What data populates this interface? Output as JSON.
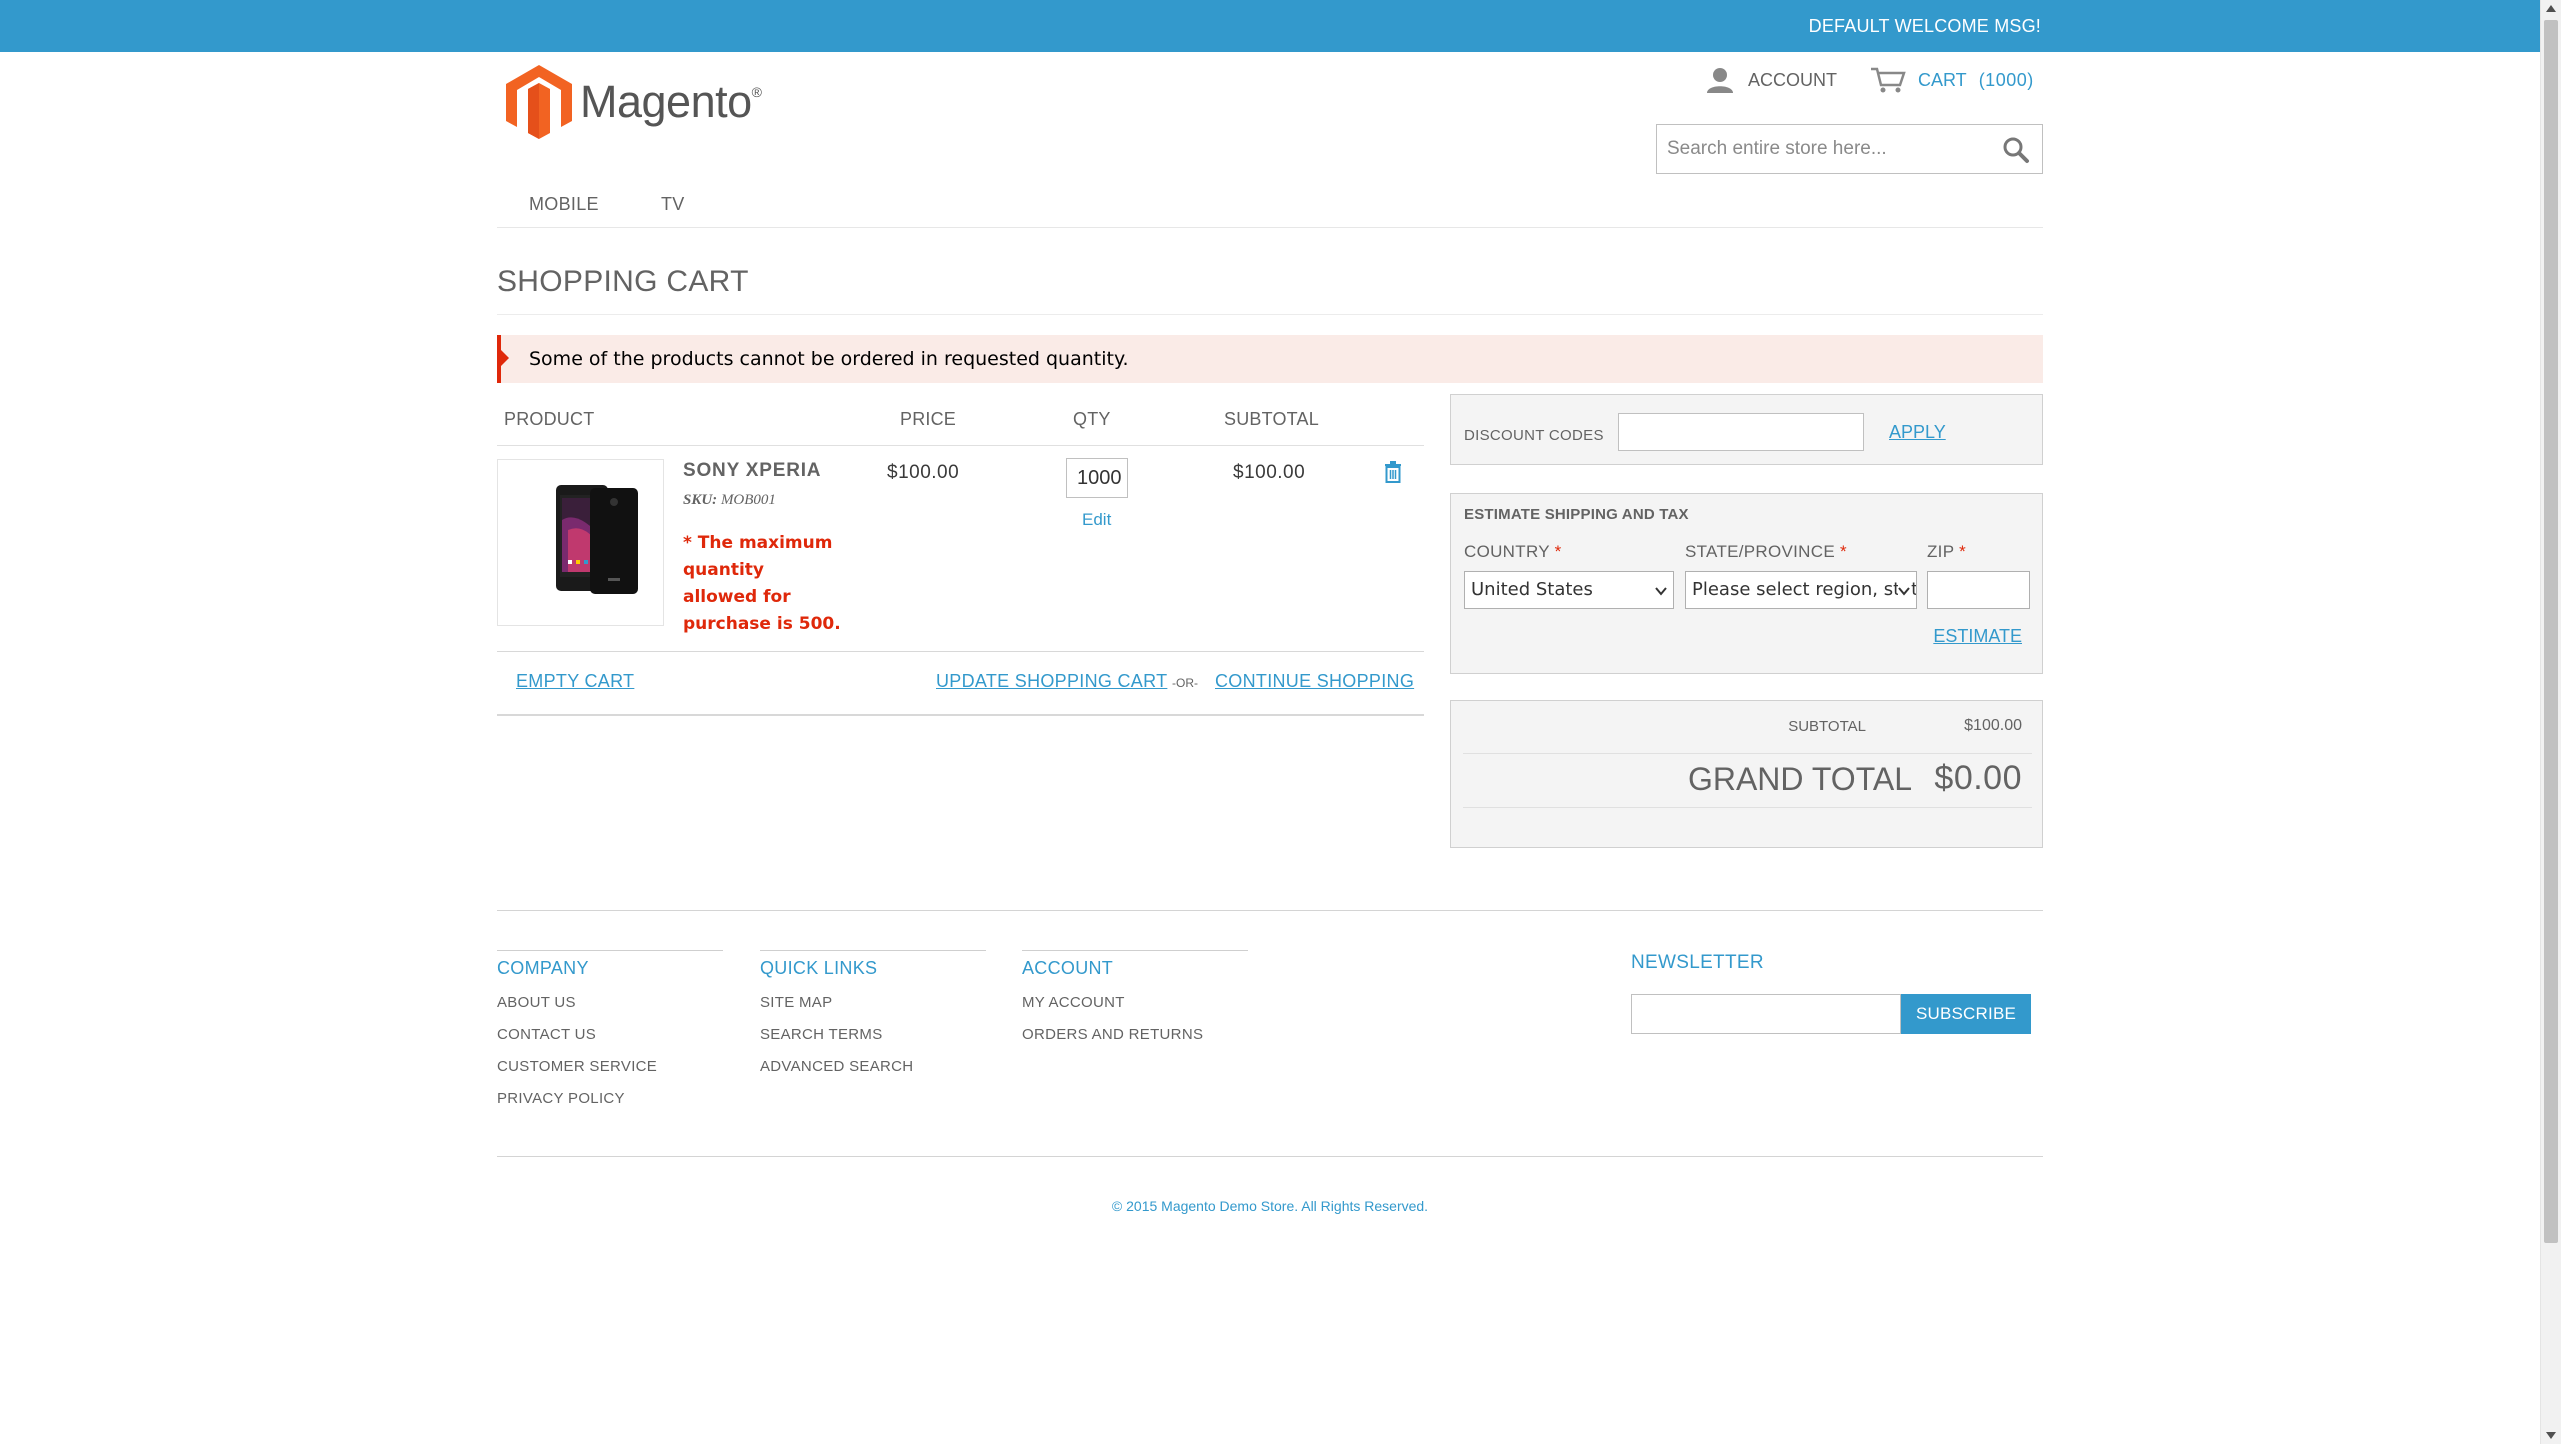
{
  "header": {
    "welcome": "DEFAULT WELCOME MSG!",
    "logo_text": "Magento",
    "logo_mark": "®",
    "account_label": "ACCOUNT",
    "cart_label": "CART",
    "cart_count": "(1000)",
    "search_placeholder": "Search entire store here..."
  },
  "nav": {
    "items": [
      "MOBILE",
      "TV"
    ]
  },
  "page": {
    "title": "SHOPPING CART",
    "error_message": "Some of the products cannot be ordered in requested quantity."
  },
  "cart": {
    "columns": {
      "product": "PRODUCT",
      "price": "PRICE",
      "qty": "QTY",
      "subtotal": "SUBTOTAL"
    },
    "item": {
      "name": "SONY XPERIA",
      "sku_label": "SKU:",
      "sku": "MOB001",
      "error": "* The maximum quantity allowed for purchase is 500.",
      "price": "$100.00",
      "qty": "1000",
      "edit_label": "Edit",
      "subtotal": "$100.00"
    },
    "actions": {
      "empty": "EMPTY CART",
      "update": "UPDATE SHOPPING CART",
      "or": "-OR-",
      "continue": "CONTINUE SHOPPING"
    }
  },
  "discount": {
    "label": "DISCOUNT CODES",
    "apply": "APPLY"
  },
  "shipping": {
    "title": "ESTIMATE SHIPPING AND TAX",
    "country_label": "COUNTRY",
    "state_label": "STATE/PROVINCE",
    "zip_label": "ZIP",
    "required_mark": "*",
    "country_value": "United States",
    "state_value": "Please select region, state or province",
    "estimate": "ESTIMATE"
  },
  "totals": {
    "subtotal_label": "SUBTOTAL",
    "subtotal_value": "$100.00",
    "grand_label": "GRAND TOTAL",
    "grand_value": "$0.00"
  },
  "footer": {
    "columns": [
      {
        "title": "COMPANY",
        "links": [
          "ABOUT US",
          "CONTACT US",
          "CUSTOMER SERVICE",
          "PRIVACY POLICY"
        ]
      },
      {
        "title": "QUICK LINKS",
        "links": [
          "SITE MAP",
          "SEARCH TERMS",
          "ADVANCED SEARCH"
        ]
      },
      {
        "title": "ACCOUNT",
        "links": [
          "MY ACCOUNT",
          "ORDERS AND RETURNS"
        ]
      }
    ],
    "newsletter_title": "NEWSLETTER",
    "subscribe": "SUBSCRIBE",
    "copyright": "© 2015 Magento Demo Store. All Rights Reserved."
  },
  "colors": {
    "accent": "#3399cc",
    "error": "#df280a",
    "error_bg": "#faebe7",
    "logo_orange": "#f26322"
  },
  "icons": [
    "magento-logo-icon",
    "account-icon",
    "cart-icon",
    "search-icon",
    "trash-icon",
    "chevron-down-icon"
  ]
}
